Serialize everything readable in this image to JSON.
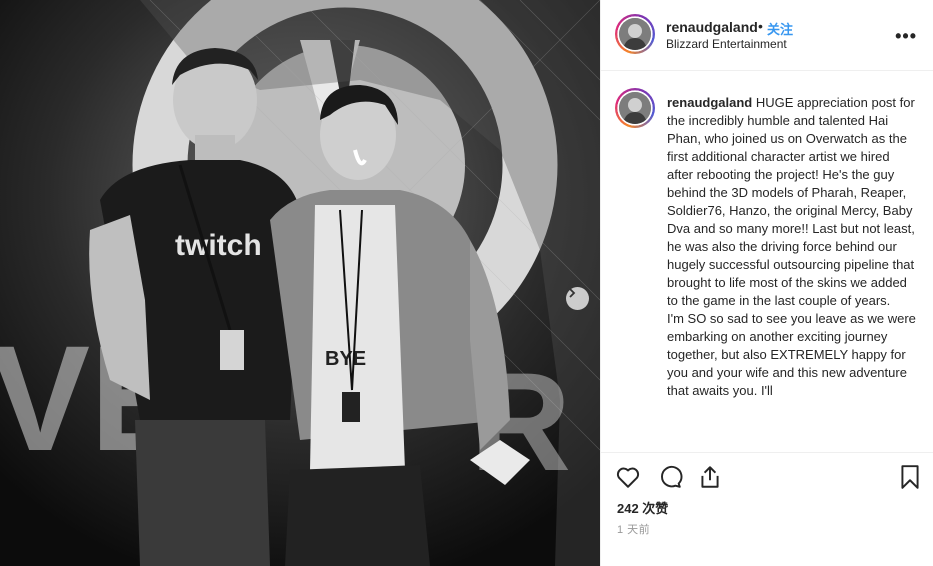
{
  "post": {
    "username": "renaudgaland",
    "separator": "•",
    "follow_label": "关注",
    "location": "Blizzard Entertainment",
    "more_label": "•••",
    "caption_username": "renaudgaland",
    "caption_text": " HUGE appreciation post for the incredibly humble and talented Hai Phan, who joined us on Overwatch as the first additional character artist we hired after rebooting the project! He's the guy behind the 3D models of Pharah, Reaper, Soldier76, Hanzo, the original Mercy, Baby Dva and so many more!! Last but not least, he was also the driving force behind our hugely successful outsourcing pipeline that brought to life most of the skins we added to the game in the last couple of years.\nI'm SO so sad to see you leave as we were embarking on another exciting journey together, but also EXTREMELY happy for you and your wife and this new adventure that awaits you. I'll",
    "likes": "242 次赞",
    "time": "1 天前"
  },
  "media": {
    "shirt_text": "twitch",
    "tee_text": "BYE"
  },
  "icons": {
    "like": "heart-icon",
    "comment": "comment-icon",
    "share": "share-icon",
    "save": "bookmark-icon",
    "next": "chevron-right-icon",
    "more": "more-icon"
  },
  "colors": {
    "follow": "#3897f0",
    "text": "#262626",
    "muted": "#999999"
  }
}
